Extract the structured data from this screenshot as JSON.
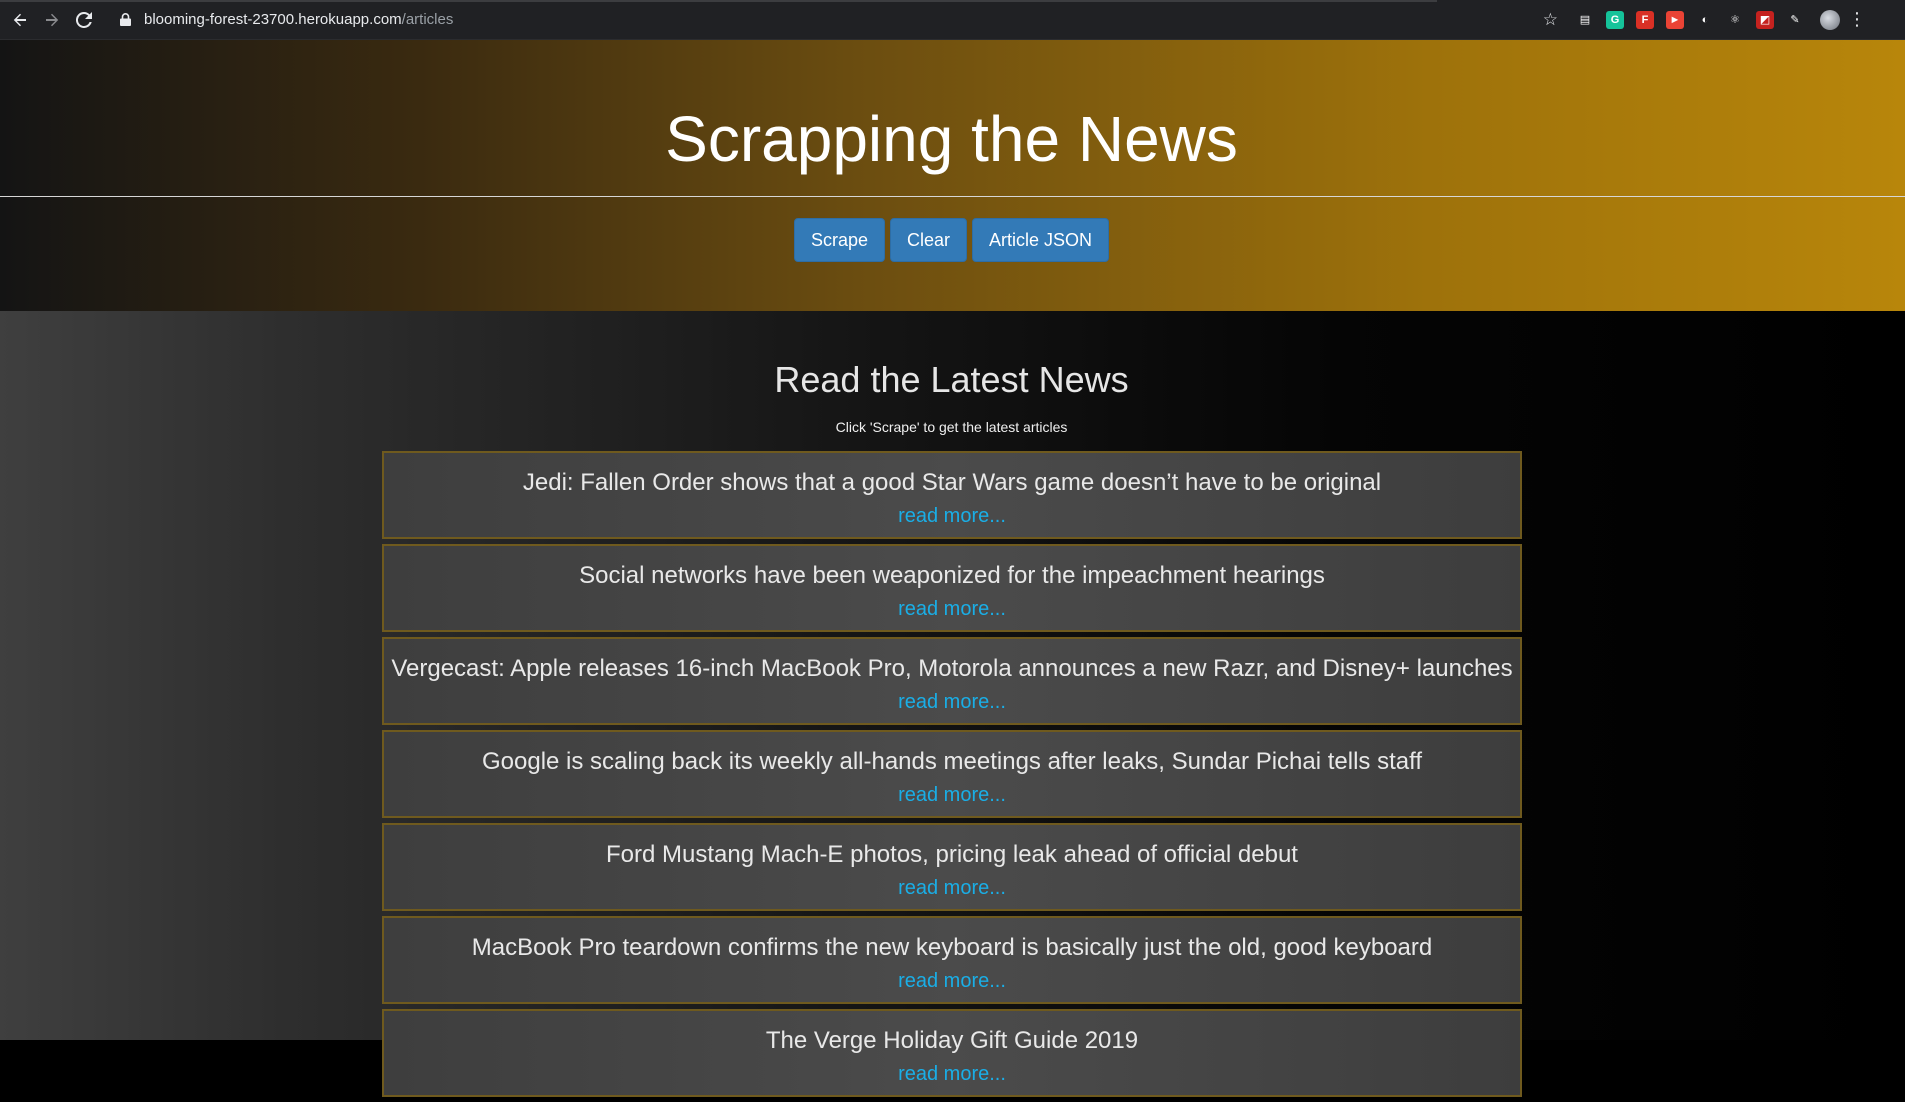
{
  "browser": {
    "url_host": "blooming-forest-23700.herokuapp.com",
    "url_path": "/articles",
    "extensions": [
      {
        "name": "reader-icon",
        "color": "#202124",
        "glyph": "▤"
      },
      {
        "name": "grammarly-icon",
        "color": "#15c39a",
        "glyph": "G"
      },
      {
        "name": "pdf-icon",
        "color": "#d93025",
        "glyph": "F"
      },
      {
        "name": "record-icon",
        "color": "#ea4335",
        "glyph": "►"
      },
      {
        "name": "circle-icon",
        "color": "#202124",
        "glyph": "◐"
      },
      {
        "name": "react-icon",
        "color": "#202124",
        "glyph": "⚛"
      },
      {
        "name": "clip-icon",
        "color": "#c5221f",
        "glyph": "◩"
      },
      {
        "name": "pen-icon",
        "color": "#202124",
        "glyph": "✎"
      }
    ]
  },
  "header": {
    "title": "Scrapping the News",
    "buttons": {
      "scrape": "Scrape",
      "clear": "Clear",
      "json": "Article JSON"
    }
  },
  "main": {
    "heading": "Read the Latest News",
    "hint": "Click 'Scrape' to get the latest articles",
    "articles": [
      {
        "title": "Jedi: Fallen Order shows that a good Star Wars game doesn’t have to be original",
        "link": "read more..."
      },
      {
        "title": "Social networks have been weaponized for the impeachment hearings",
        "link": "read more..."
      },
      {
        "title": "Vergecast: Apple releases 16-inch MacBook Pro, Motorola announces a new Razr, and Disney+ launches",
        "link": "read more..."
      },
      {
        "title": "Google is scaling back its weekly all-hands meetings after leaks, Sundar Pichai tells staff",
        "link": "read more..."
      },
      {
        "title": "Ford Mustang Mach-E photos, pricing leak ahead of official debut",
        "link": "read more..."
      },
      {
        "title": "MacBook Pro teardown confirms the new keyboard is basically just the old, good keyboard",
        "link": "read more..."
      },
      {
        "title": "The Verge Holiday Gift Guide 2019",
        "link": "read more..."
      }
    ]
  }
}
